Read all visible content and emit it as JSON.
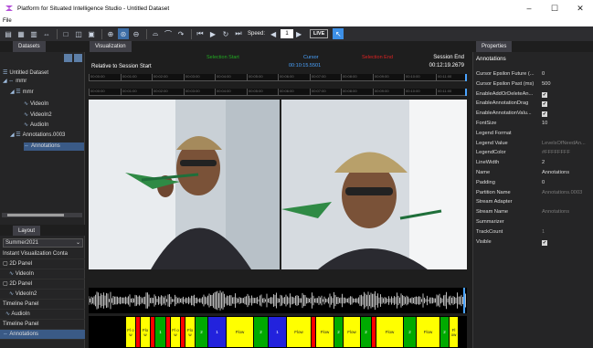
{
  "window": {
    "title": "Platform for Situated Intelligence Studio - Untitled Dataset",
    "controls": [
      "–",
      "☐",
      "✕"
    ]
  },
  "menu": {
    "file": "File"
  },
  "toolbar": {
    "speed_label": "Speed:",
    "speed_value": "1",
    "live_label": "LIVE"
  },
  "datasets": {
    "tab": "Datasets",
    "tree": [
      {
        "label": "Untitled Dataset",
        "icon": "dataset-icon"
      },
      {
        "label": "mmr",
        "icon": "session-icon"
      },
      {
        "label": "mmr",
        "icon": "partition-icon"
      },
      {
        "label": "VideoIn",
        "icon": "stream-icon"
      },
      {
        "label": "VideoIn2",
        "icon": "stream-icon"
      },
      {
        "label": "AudioIn",
        "icon": "stream-icon"
      },
      {
        "label": "Annotations.0003",
        "icon": "partition-icon"
      },
      {
        "label": "Annotations",
        "icon": "annotation-stream-icon"
      }
    ]
  },
  "layout": {
    "tab": "Layout",
    "selected": "Summer2021",
    "items": [
      "Instant Visualization Conta",
      "2D Panel",
      "VideoIn",
      "2D Panel",
      "VideoIn2",
      "Timeline Panel",
      "AudioIn",
      "Timeline Panel",
      "Annotations"
    ]
  },
  "visualization": {
    "tab": "Visualization",
    "relative_label": "Relative to Session Start",
    "selection_start_label": "Selection Start",
    "cursor_label": "Cursor",
    "cursor_time": "00:10:15.5501",
    "selection_end_label": "Selection End",
    "session_end_label": "Session End",
    "session_end_time": "00:12:19.2679",
    "ruler_labels": [
      "00:00:00",
      "00:01:00",
      "00:02:00",
      "00:03:00",
      "00:04:00",
      "00:05:00",
      "00:06:00",
      "00:07:00",
      "00:08:00",
      "00:09:00",
      "00:10:00",
      "00:11:00"
    ]
  },
  "annotations": [
    {
      "label": "Fl o w",
      "color": "#ffff00"
    },
    {
      "label": "",
      "color": "#ff0000"
    },
    {
      "label": "Flo w",
      "color": "#ffff00"
    },
    {
      "label": "",
      "color": "#ff0000"
    },
    {
      "label": "1",
      "color": "#00aa00"
    },
    {
      "label": "",
      "color": "#ff0000"
    },
    {
      "label": "Fl o w",
      "color": "#ffff00"
    },
    {
      "label": "",
      "color": "#ff0000"
    },
    {
      "label": "Flo w",
      "color": "#ffff00"
    },
    {
      "label": "2",
      "color": "#00aa00"
    },
    {
      "label": "1",
      "color": "#2222dd"
    },
    {
      "label": "Flow",
      "color": "#ffff00"
    },
    {
      "label": "2",
      "color": "#00aa00"
    },
    {
      "label": "1",
      "color": "#2222dd"
    },
    {
      "label": "Flow",
      "color": "#ffff00"
    },
    {
      "label": "",
      "color": "#ff0000"
    },
    {
      "label": "Flow",
      "color": "#ffff00"
    },
    {
      "label": "2",
      "color": "#00aa00"
    },
    {
      "label": "Flow",
      "color": "#ffff00"
    },
    {
      "label": "2",
      "color": "#00aa00"
    },
    {
      "label": "",
      "color": "#ff0000"
    },
    {
      "label": "Flow",
      "color": "#ffff00"
    },
    {
      "label": "2",
      "color": "#00aa00"
    },
    {
      "label": "Flow",
      "color": "#ffff00"
    },
    {
      "label": "2",
      "color": "#00aa00"
    },
    {
      "label": "Fl ow",
      "color": "#ffff00"
    }
  ],
  "properties": {
    "tab": "Properties",
    "header": "Annotations",
    "rows": [
      {
        "name": "Cursor Epsilon Future (...",
        "value": "0",
        "type": "text"
      },
      {
        "name": "Cursor Epsilon Past (ms)",
        "value": "500",
        "type": "text"
      },
      {
        "name": "EnableAddOrDeleteAn...",
        "value": "✔",
        "type": "check"
      },
      {
        "name": "EnableAnnotationDrag",
        "value": "✔",
        "type": "check"
      },
      {
        "name": "EnableAnnotationValu...",
        "value": "✔",
        "type": "check"
      },
      {
        "name": "FontSize",
        "value": "10",
        "type": "text"
      },
      {
        "name": "Legend Format",
        "value": "",
        "type": "text"
      },
      {
        "name": "Legend Value",
        "value": "LevelsOfNeedAn...",
        "type": "dim"
      },
      {
        "name": "LegendColor",
        "value": "#FFFFFFFF",
        "type": "dim"
      },
      {
        "name": "LineWidth",
        "value": "2",
        "type": "text"
      },
      {
        "name": "Name",
        "value": "Annotations",
        "type": "text"
      },
      {
        "name": "Padding",
        "value": "0",
        "type": "text"
      },
      {
        "name": "Partition Name",
        "value": "Annotations.0003",
        "type": "dim"
      },
      {
        "name": "Stream Adapter",
        "value": "",
        "type": "text"
      },
      {
        "name": "Stream Name",
        "value": "Annotations",
        "type": "dim"
      },
      {
        "name": "Summarizer",
        "value": "",
        "type": "text"
      },
      {
        "name": "TrackCount",
        "value": "1",
        "type": "dim"
      },
      {
        "name": "Visible",
        "value": "✔",
        "type": "check"
      }
    ]
  },
  "colors": {
    "selection_start": "#22aa22",
    "cursor": "#4aa3ff",
    "selection_end": "#dd2222",
    "accent": "#3c8fe6"
  }
}
